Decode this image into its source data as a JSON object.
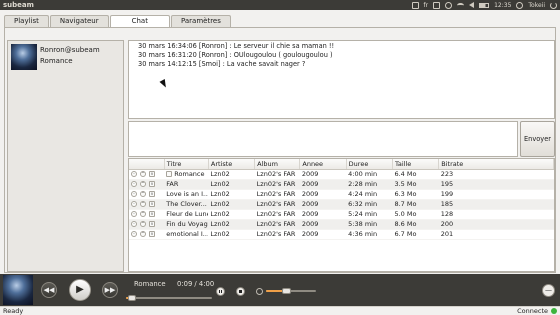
{
  "app": {
    "title": "subeam"
  },
  "system_tray": {
    "language": "fr",
    "clock": "12:35",
    "user": "Tokeii"
  },
  "tabs": [
    {
      "label": "Playlist"
    },
    {
      "label": "Navigateur"
    },
    {
      "label": "Chat",
      "active": true
    },
    {
      "label": "Paramètres"
    }
  ],
  "user_panel": {
    "username": "Ronron@subeam",
    "current_track": "Romance"
  },
  "chat": {
    "messages": [
      {
        "text": "30 mars 16:34:06 [Ronron] : Le serveur il chie sa maman !!"
      },
      {
        "text": "30 mars 16:31:20 [Ronron] : OUlougoulou ( goulougoulou )"
      },
      {
        "text": "30 mars 14:12:15 [Smoi] : La vache savait nager ?"
      }
    ],
    "input_value": "",
    "send_label": "Envoyer"
  },
  "playlist": {
    "columns": [
      "Titre",
      "Artiste",
      "Album",
      "Annee",
      "Duree",
      "Taille",
      "Bitrate"
    ],
    "rows": [
      {
        "title": "Romance",
        "artist": "Lzn02",
        "album": "Lzn02's FAR",
        "year": "2009",
        "duration": "4:00 min",
        "size": "6.4  Mo",
        "bitrate": "223"
      },
      {
        "title": "FAR",
        "artist": "Lzn02",
        "album": "Lzn02's FAR",
        "year": "2009",
        "duration": "2:28 min",
        "size": "3.5  Mo",
        "bitrate": "195"
      },
      {
        "title": "Love is an I...",
        "artist": "Lzn02",
        "album": "Lzn02's FAR",
        "year": "2009",
        "duration": "4:24 min",
        "size": "6.3  Mo",
        "bitrate": "199"
      },
      {
        "title": "The Clover...",
        "artist": "Lzn02",
        "album": "Lzn02's FAR",
        "year": "2009",
        "duration": "6:32 min",
        "size": "8.7  Mo",
        "bitrate": "185"
      },
      {
        "title": "Fleur de Lune",
        "artist": "Lzn02",
        "album": "Lzn02's FAR",
        "year": "2009",
        "duration": "5:24 min",
        "size": "5.0  Mo",
        "bitrate": "128"
      },
      {
        "title": "Fin du Voyage",
        "artist": "Lzn02",
        "album": "Lzn02's FAR",
        "year": "2009",
        "duration": "5:38 min",
        "size": "8.6  Mo",
        "bitrate": "200"
      },
      {
        "title": "emotional I...",
        "artist": "Lzn02",
        "album": "Lzn02's FAR",
        "year": "2009",
        "duration": "4:36 min",
        "size": "6.7  Mo",
        "bitrate": "201"
      }
    ]
  },
  "player": {
    "now_playing": "Romance",
    "time": "0:09 / 4:00",
    "progress_fraction": 0.04,
    "volume_fraction": 0.4
  },
  "status": {
    "left": "Ready",
    "right": "Connecte",
    "connected_color": "#3cb43c"
  },
  "icons": [
    "keyboard-icon",
    "mail-icon",
    "bluetooth-icon",
    "wifi-icon",
    "volume-icon",
    "battery-icon",
    "user-icon",
    "power-icon",
    "previous-icon",
    "play-icon",
    "next-icon",
    "pause-icon",
    "stop-icon",
    "speaker-icon",
    "expand-icon"
  ]
}
